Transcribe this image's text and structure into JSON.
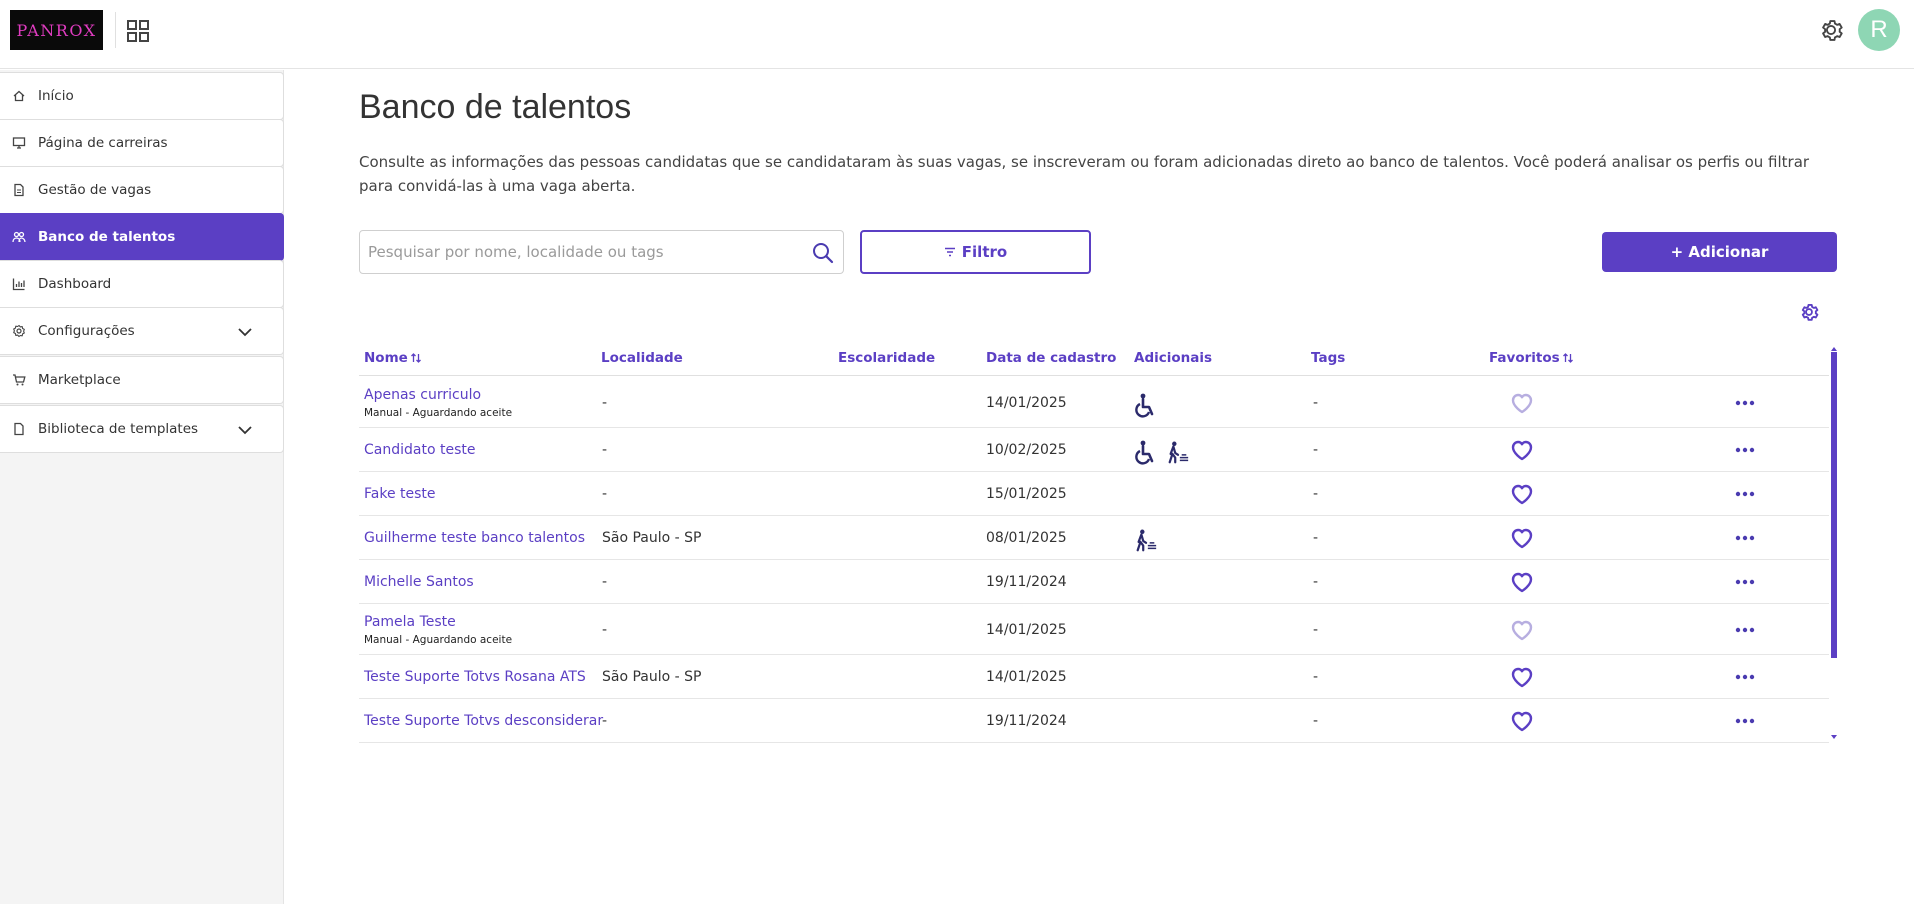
{
  "header": {
    "logo_text": "PANROX",
    "apps_icon": "grid-icon",
    "settings_icon": "gear-icon",
    "avatar_initial": "R"
  },
  "sidebar": {
    "items": [
      {
        "label": "Início",
        "icon": "home-icon"
      },
      {
        "label": "Página de carreiras",
        "icon": "monitor-icon"
      },
      {
        "label": "Gestão de vagas",
        "icon": "document-icon"
      },
      {
        "label": "Banco de talentos",
        "icon": "people-icon",
        "active": true
      },
      {
        "label": "Dashboard",
        "icon": "chart-icon"
      },
      {
        "label": "Configurações",
        "icon": "gear-icon",
        "expandable": true
      },
      {
        "label": "Marketplace",
        "icon": "cart-icon"
      },
      {
        "label": "Biblioteca de templates",
        "icon": "document-icon",
        "expandable": true
      }
    ]
  },
  "main": {
    "title": "Banco de talentos",
    "description": "Consulte as informações das pessoas candidatas que se candidataram às suas vagas, se inscreveram ou foram adicionadas direto ao banco de talentos. Você poderá analisar os perfis ou filtrar para convidá-las à uma vaga aberta.",
    "search_placeholder": "Pesquisar por nome, localidade ou tags",
    "search_value": "",
    "filter_label": "Filtro",
    "add_label": "+ Adicionar"
  },
  "table": {
    "columns": [
      "Nome",
      "Localidade",
      "Escolaridade",
      "Data de cadastro",
      "Adicionais",
      "Tags",
      "Favoritos"
    ],
    "rows": [
      {
        "name": "Apenas curriculo",
        "sub": "Manual - Aguardando aceite",
        "localidade": "-",
        "escolaridade": "",
        "data": "14/01/2025",
        "adicionais": [
          "wheelchair-icon"
        ],
        "tags": "-",
        "favorito": "inactive"
      },
      {
        "name": "Candidato teste",
        "sub": "",
        "localidade": "-",
        "escolaridade": "",
        "data": "10/02/2025",
        "adicionais": [
          "wheelchair-icon",
          "first-job-icon"
        ],
        "tags": "-",
        "favorito": "active"
      },
      {
        "name": "Fake teste",
        "sub": "",
        "localidade": "-",
        "escolaridade": "",
        "data": "15/01/2025",
        "adicionais": [],
        "tags": "-",
        "favorito": "active"
      },
      {
        "name": "Guilherme teste banco talentos",
        "sub": "",
        "localidade": "São Paulo - SP",
        "escolaridade": "",
        "data": "08/01/2025",
        "adicionais": [
          "first-job-icon"
        ],
        "tags": "-",
        "favorito": "active"
      },
      {
        "name": "Michelle Santos",
        "sub": "",
        "localidade": "-",
        "escolaridade": "",
        "data": "19/11/2024",
        "adicionais": [],
        "tags": "-",
        "favorito": "active"
      },
      {
        "name": "Pamela Teste",
        "sub": "Manual - Aguardando aceite",
        "localidade": "-",
        "escolaridade": "",
        "data": "14/01/2025",
        "adicionais": [],
        "tags": "-",
        "favorito": "inactive"
      },
      {
        "name": "Teste Suporte Totvs Rosana ATS",
        "sub": "",
        "localidade": "São Paulo - SP",
        "escolaridade": "",
        "data": "14/01/2025",
        "adicionais": [],
        "tags": "-",
        "favorito": "active"
      },
      {
        "name": "Teste Suporte Totvs desconsiderar",
        "sub": "",
        "localidade": "-",
        "escolaridade": "",
        "data": "19/11/2024",
        "adicionais": [],
        "tags": "-",
        "favorito": "active"
      }
    ]
  },
  "colors": {
    "accent": "#5b3fc4",
    "avatar_bg": "#8ed6b4",
    "heart_inactive": "#b7aee0"
  }
}
